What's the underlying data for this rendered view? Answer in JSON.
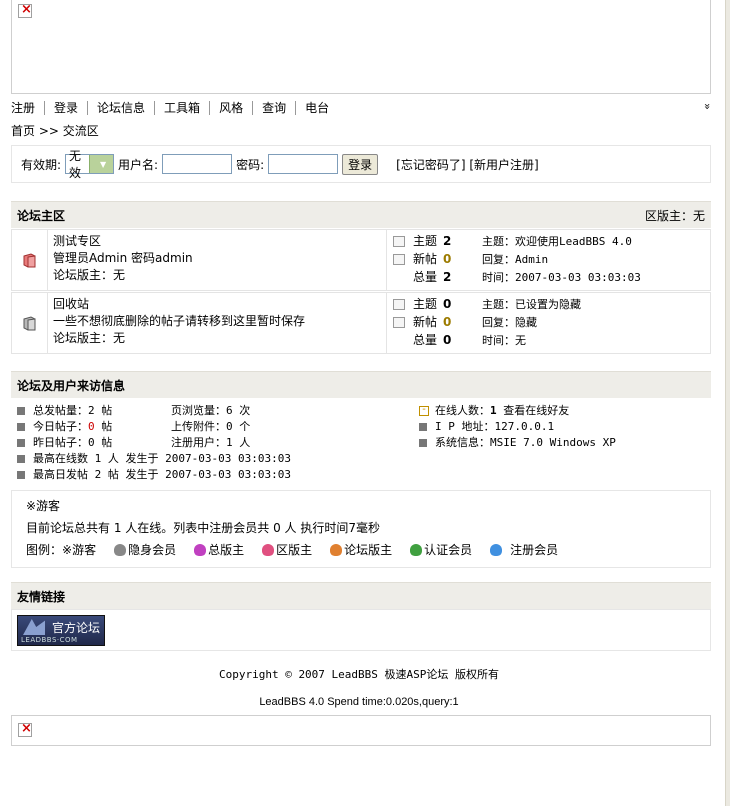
{
  "nav": {
    "items": [
      "注册",
      "登录",
      "论坛信息",
      "工具箱",
      "风格",
      "查询",
      "电台"
    ],
    "expand": "»"
  },
  "breadcrumb": {
    "home": "首页",
    "sep": ">>",
    "current": "交流区"
  },
  "login": {
    "validity_label": "有效期:",
    "validity_value": "无效",
    "username_label": "用户名:",
    "password_label": "密码:",
    "login_button": "登录",
    "forgot": "[忘记密码了]",
    "register": "[新用户注册]"
  },
  "main_section": {
    "title": "论坛主区",
    "moderator": "区版主：无"
  },
  "forums": [
    {
      "name": "测试专区",
      "desc": "管理员Admin 密码admin",
      "mods": "论坛版主：无",
      "topics_label": "主题",
      "topics": "2",
      "new_label": "新帖",
      "new": "0",
      "total_label": "总量",
      "total": "2",
      "last_topic": "主题：欢迎使用LeadBBS 4.0",
      "last_reply": "回复：Admin",
      "last_time": "时间：2007-03-03 03:03:03"
    },
    {
      "name": "回收站",
      "desc": "一些不想彻底删除的帖子请转移到这里暂时保存",
      "mods": "论坛版主：无",
      "topics_label": "主题",
      "topics": "0",
      "new_label": "新帖",
      "new": "0",
      "total_label": "总量",
      "total": "0",
      "last_topic": "主题：已设置为隐藏",
      "last_reply": "回复：隐藏",
      "last_time": "时间：无"
    }
  ],
  "visit_section": {
    "title": "论坛及用户来访信息"
  },
  "stats": {
    "total_posts": "总发帖量：2 帖",
    "page_views": "页浏览量：6 次",
    "today_posts_label": "今日帖子：",
    "today_posts_value": "0",
    "today_posts_unit": " 帖",
    "uploads": "上传附件：0 个",
    "yesterday_posts": "昨日帖子：0 帖",
    "registered": "注册用户：1 人",
    "max_online": "最高在线数 1 人 发生于 2007-03-03 03:03:03",
    "max_daily": "最高日发帖 2 帖 发生于 2007-03-03 03:03:03",
    "online_label": "在线人数：",
    "online_value": "1",
    "online_link": "查看在线好友",
    "ip": "I P 地址：127.0.0.1",
    "sysinfo": "系统信息：MSIE 7.0 Windows XP"
  },
  "guests": {
    "guest_label": "※游客",
    "summary": "目前论坛总共有 1 人在线。列表中注册会员共 0 人 执行时间7毫秒",
    "legend_label": "图例：",
    "legend": [
      {
        "label": "※游客",
        "icon": "guest-icon",
        "color": ""
      },
      {
        "label": "隐身会员",
        "icon": "hidden-member-icon",
        "color": "#888888"
      },
      {
        "label": "总版主",
        "icon": "super-moderator-icon",
        "color": "#c040c0"
      },
      {
        "label": "区版主",
        "icon": "area-moderator-icon",
        "color": "#e05080"
      },
      {
        "label": "论坛版主",
        "icon": "forum-moderator-icon",
        "color": "#e08030"
      },
      {
        "label": "认证会员",
        "icon": "verified-member-icon",
        "color": "#40a040"
      },
      {
        "label": "注册会员",
        "icon": "registered-member-icon",
        "color": "#4090e0"
      }
    ]
  },
  "links_section": {
    "title": "友情链接"
  },
  "logo": {
    "text": "官方论坛",
    "sub": "LEADBBS·COM"
  },
  "footer": {
    "copyright": "Copyright © 2007 LeadBBS 极速ASP论坛 版权所有",
    "spend": "LeadBBS 4.0 Spend time:0.020s,query:1"
  }
}
